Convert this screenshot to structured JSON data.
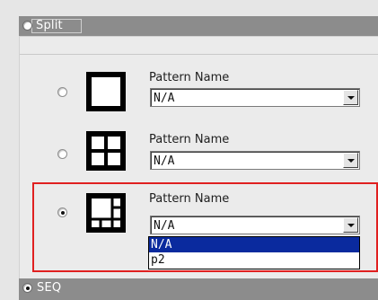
{
  "sections": {
    "split": {
      "label": "Split",
      "selected": false
    },
    "seq": {
      "label": "SEQ",
      "selected": true
    }
  },
  "rows": [
    {
      "icon": "single-pane-pattern-icon",
      "selected": false,
      "field_label": "Pattern Name",
      "value": "N/A"
    },
    {
      "icon": "quad-pane-pattern-icon",
      "selected": false,
      "field_label": "Pattern Name",
      "value": "N/A"
    },
    {
      "icon": "multi-pane-pattern-icon",
      "selected": true,
      "field_label": "Pattern Name",
      "value": "N/A"
    }
  ],
  "dropdown": {
    "options": [
      "N/A",
      "p2"
    ],
    "highlighted": "N/A"
  },
  "colors": {
    "header_bar": "#8c8c8c",
    "panel_bg": "#ebebeb",
    "selection_bg": "#0a2a9e",
    "annotation_box": "#e02020"
  }
}
